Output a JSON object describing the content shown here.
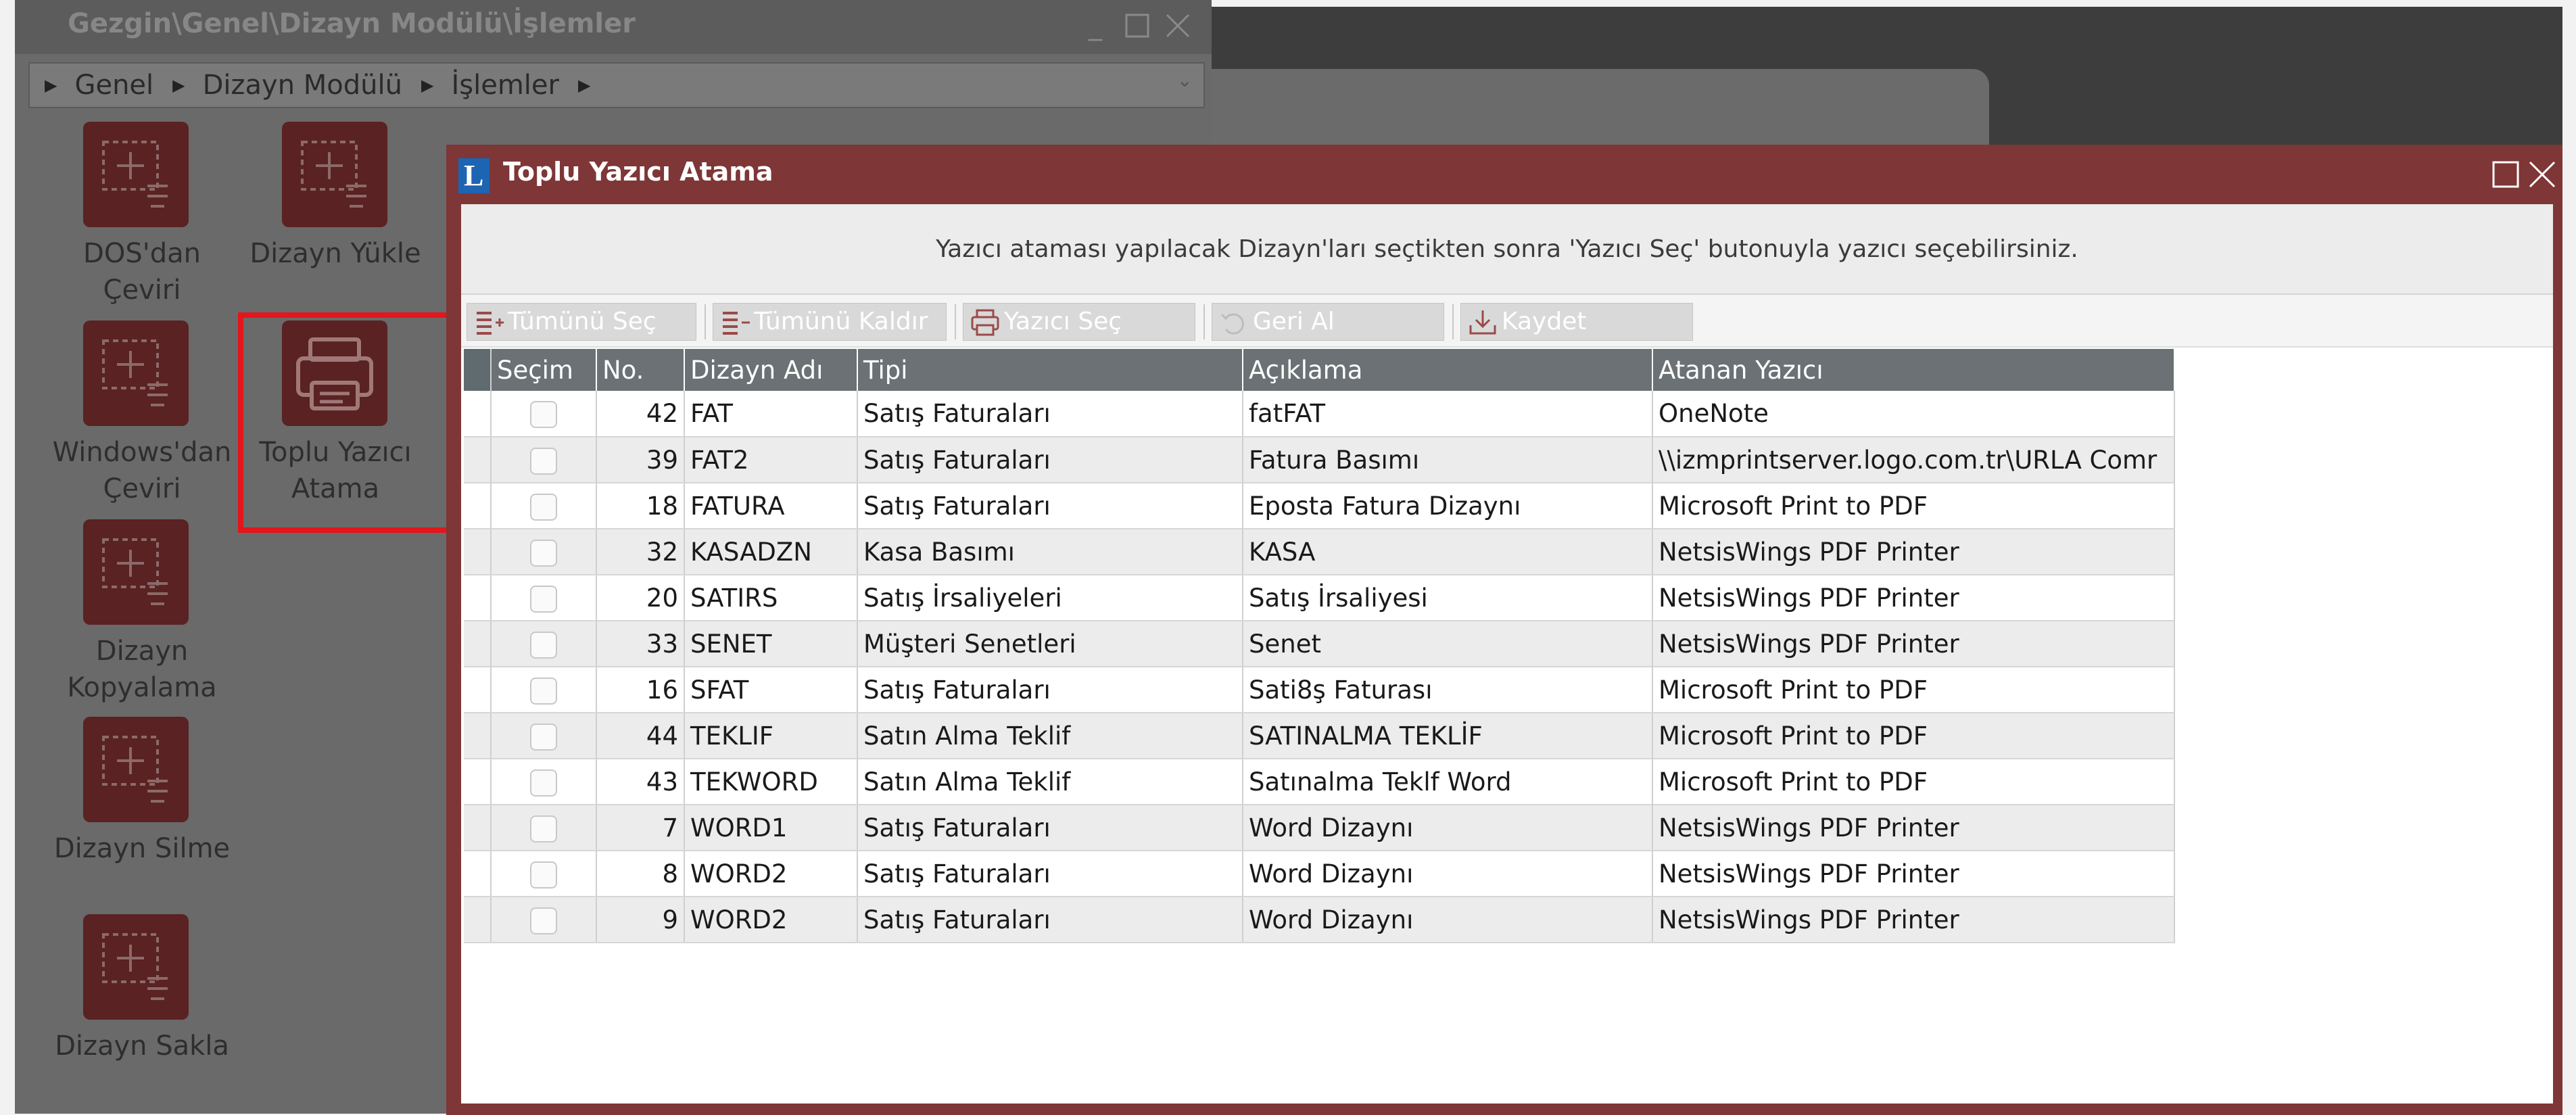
{
  "explorer": {
    "title": "Gezgin\\Genel\\Dizayn Modülü\\İşlemler",
    "breadcrumb": [
      "Genel",
      "Dizayn Modülü",
      "İşlemler"
    ],
    "tiles": [
      {
        "label": "DOS'dan Çeviri"
      },
      {
        "label": "Dizayn Yükle"
      },
      {
        "label": "Windows'dan Çeviri"
      },
      {
        "label": "Toplu Yazıcı Atama"
      },
      {
        "label": "Dizayn Kopyalama"
      },
      {
        "label": "Dizayn Silme"
      },
      {
        "label": "Dizayn Sakla"
      }
    ],
    "tile_lines": {
      "dos1": "DOS'dan Çeviri",
      "yukle1": "Dizayn Yükle",
      "win1": "Windows'dan",
      "win2": "Çeviri",
      "toplu1": "Toplu Yazıcı",
      "toplu2": "Atama",
      "kop1": "Dizayn",
      "kop2": "Kopyalama",
      "silme1": "Dizayn Silme",
      "sakla1": "Dizayn Sakla"
    }
  },
  "dialog": {
    "logo_letter": "L",
    "title": "Toplu Yazıcı Atama",
    "info_text": "Yazıcı ataması yapılacak Dizayn'ları seçtikten sonra 'Yazıcı Seç' butonuyla yazıcı seçebilirsiniz.",
    "toolbar": {
      "select_all": "Tümünü Seç",
      "deselect_all": "Tümünü Kaldır",
      "select_printer": "Yazıcı Seç",
      "undo": "Geri Al",
      "save": "Kaydet"
    },
    "columns": {
      "secim": "Seçim",
      "no": "No.",
      "dizayn_adi": "Dizayn Adı",
      "tipi": "Tipi",
      "aciklama": "Açıklama",
      "atanan_yazici": "Atanan Yazıcı"
    },
    "rows": [
      {
        "no": "42",
        "name": "FAT",
        "type": "Satış Faturaları",
        "desc": "fatFAT",
        "printer": "OneNote",
        "selected": false
      },
      {
        "no": "39",
        "name": "FAT2",
        "type": "Satış Faturaları",
        "desc": "Fatura Basımı",
        "printer": "\\\\izmprintserver.logo.com.tr\\URLA Comr",
        "selected": false
      },
      {
        "no": "18",
        "name": "FATURA",
        "type": "Satış Faturaları",
        "desc": "Eposta Fatura Dizaynı",
        "printer": "Microsoft Print to PDF",
        "selected": false
      },
      {
        "no": "32",
        "name": "KASADZN",
        "type": "Kasa Basımı",
        "desc": "KASA",
        "printer": "NetsisWings PDF Printer",
        "selected": false
      },
      {
        "no": "20",
        "name": "SATIRS",
        "type": "Satış İrsaliyeleri",
        "desc": "Satış İrsaliyesi",
        "printer": "NetsisWings PDF Printer",
        "selected": false
      },
      {
        "no": "33",
        "name": "SENET",
        "type": "Müşteri Senetleri",
        "desc": "Senet",
        "printer": "NetsisWings PDF Printer",
        "selected": false
      },
      {
        "no": "16",
        "name": "SFAT",
        "type": "Satış Faturaları",
        "desc": "Sati8ş Faturası",
        "printer": "Microsoft Print to PDF",
        "selected": false
      },
      {
        "no": "44",
        "name": "TEKLIF",
        "type": "Satın Alma Teklif",
        "desc": "SATINALMA TEKLİF",
        "printer": "Microsoft Print to PDF",
        "selected": false
      },
      {
        "no": "43",
        "name": "TEKWORD",
        "type": "Satın Alma Teklif",
        "desc": "Satınalma Teklf Word",
        "printer": "Microsoft Print to PDF",
        "selected": false
      },
      {
        "no": "7",
        "name": "WORD1",
        "type": "Satış Faturaları",
        "desc": "Word Dizaynı",
        "printer": "NetsisWings PDF Printer",
        "selected": false
      },
      {
        "no": "8",
        "name": "WORD2",
        "type": "Satış Faturaları",
        "desc": "Word Dizaynı",
        "printer": "NetsisWings PDF Printer",
        "selected": false
      },
      {
        "no": "9",
        "name": "WORD2",
        "type": "Satış Faturaları",
        "desc": "Word Dizaynı",
        "printer": "NetsisWings PDF Printer",
        "selected": false
      }
    ]
  },
  "colors": {
    "dialog_frame": "#7e3636",
    "grid_header": "#6b7174",
    "tile_icon": "#5a2222",
    "highlight": "#e4151b",
    "logo": "#1d64b3"
  }
}
